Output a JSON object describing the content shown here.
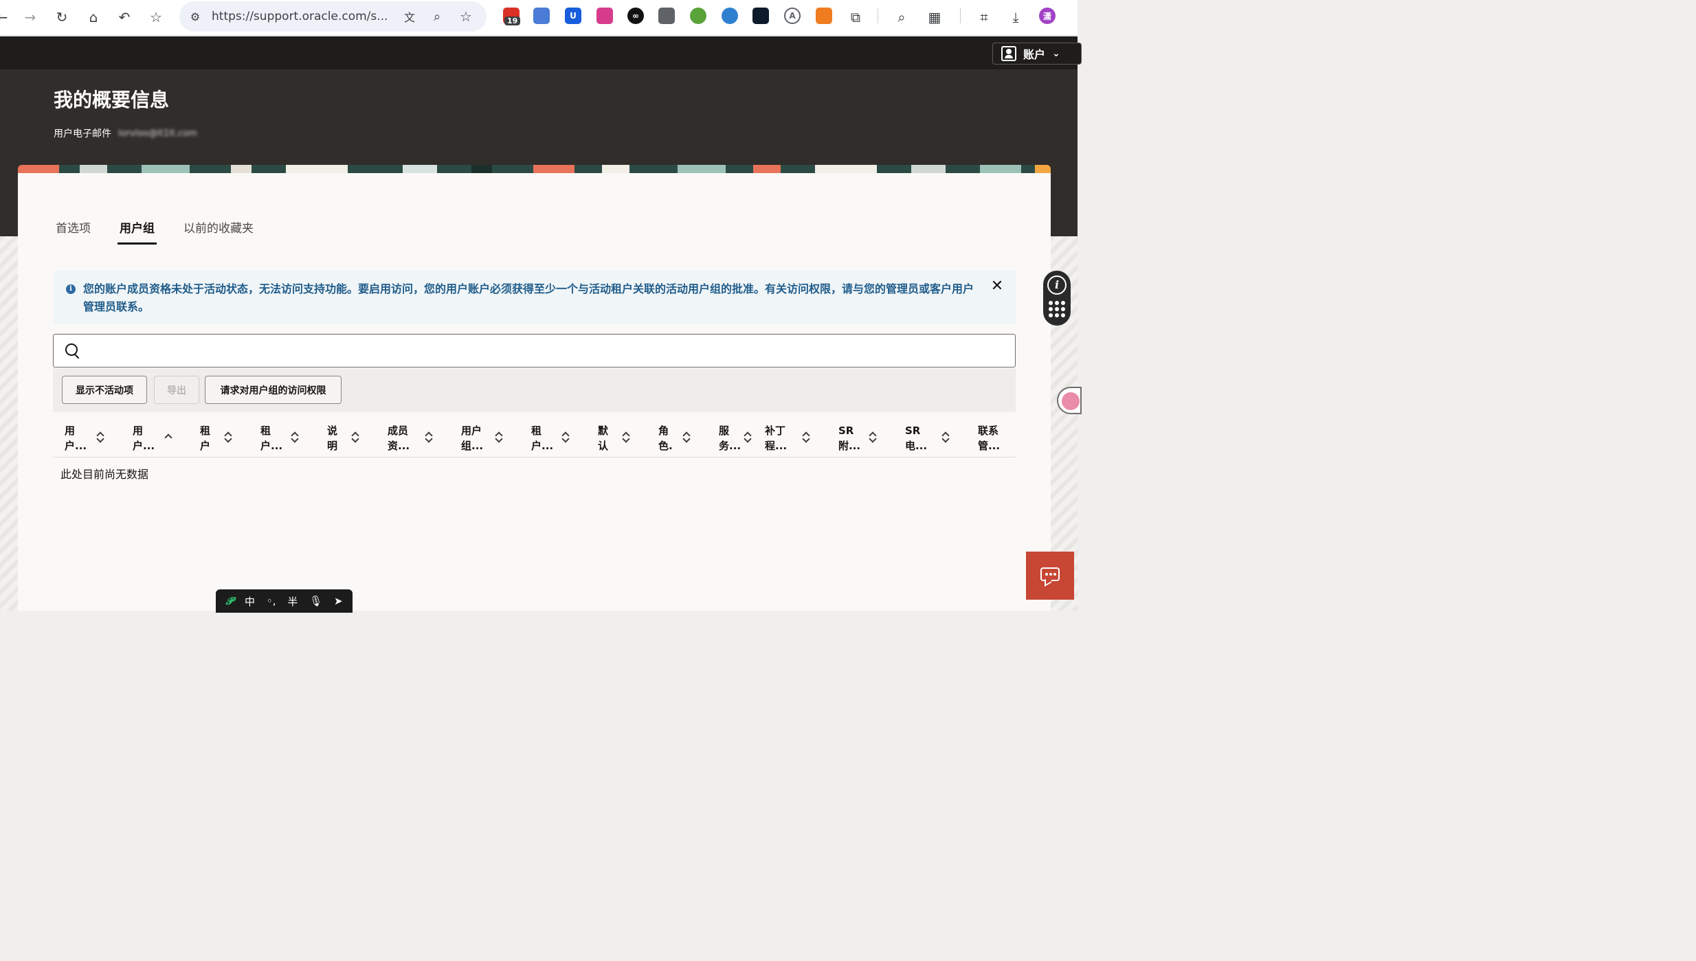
{
  "browser": {
    "url": "https://support.oracle.com/s...",
    "badge_count": "19",
    "profile_initial": "潇"
  },
  "header": {
    "account_label": "账户",
    "page_title": "我的概要信息",
    "email_label": "用户电子邮件",
    "email_value": "lorvloo@lt1lt.com"
  },
  "tabs": [
    {
      "label": "首选项",
      "active": false
    },
    {
      "label": "用户组",
      "active": true
    },
    {
      "label": "以前的收藏夹",
      "active": false
    }
  ],
  "info_message": "您的账户成员资格未处于活动状态，无法访问支持功能。要启用访问，您的用户账户必须获得至少一个与活动租户关联的活动用户组的批准。有关访问权限，请与您的管理员或客户用户管理员联系。",
  "search": {
    "placeholder": ""
  },
  "toolbar": {
    "show_inactive": "显示不活动项",
    "export": "导出",
    "request_access": "请求对用户组的访问权限"
  },
  "table": {
    "columns": [
      {
        "line1": "用",
        "line2": "户..."
      },
      {
        "line1": "用",
        "line2": "户..."
      },
      {
        "line1": "租",
        "line2": "户"
      },
      {
        "line1": "租",
        "line2": "户..."
      },
      {
        "line1": "说",
        "line2": "明"
      },
      {
        "line1": "成员",
        "line2": "资..."
      },
      {
        "line1": "用户",
        "line2": "组..."
      },
      {
        "line1": "租",
        "line2": "户..."
      },
      {
        "line1": "默",
        "line2": "认"
      },
      {
        "line1": "角",
        "line2": "色."
      },
      {
        "line1": "服",
        "line2": "务..."
      },
      {
        "line1": "补丁",
        "line2": "程..."
      },
      {
        "line1": "SR",
        "line2": "附..."
      },
      {
        "line1": "SR",
        "line2": "电..."
      },
      {
        "line1": "联系",
        "line2": "管..."
      }
    ],
    "empty_text": "此处目前尚无数据"
  },
  "ime": {
    "logo": "𝓟",
    "lang": "中",
    "punct": "◦,",
    "width": "半"
  },
  "colors": {
    "hero_bg": "#312d2a",
    "topbar_bg": "#1f1d1b",
    "info_text": "#1f5c8a",
    "chat_button": "#c74634"
  }
}
